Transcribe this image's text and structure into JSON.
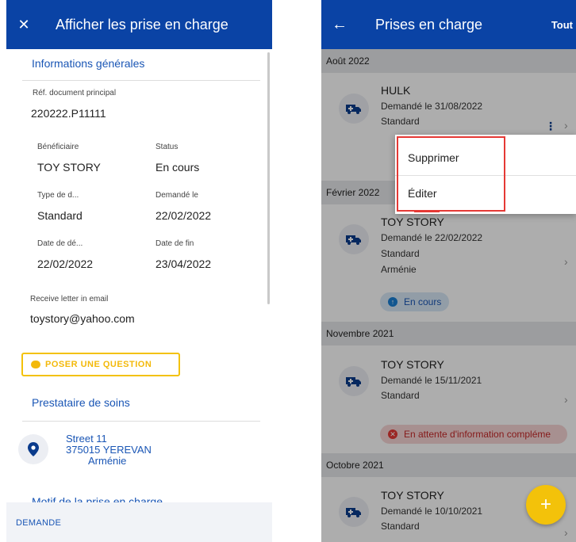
{
  "left": {
    "title": "Afficher les prise en charge",
    "section_general": "Informations générales",
    "fields": {
      "ref_label": "Réf. document principal",
      "ref_value": "220222.P11111",
      "beneficiaire_label": "Bénéficiaire",
      "beneficiaire_value": "TOY STORY",
      "status_label": "Status",
      "status_value": "En cours",
      "type_label": "Type de d...",
      "type_value": "Standard",
      "demande_label": "Demandé le",
      "demande_value": "22/02/2022",
      "date_debut_label": "Date de dé...",
      "date_debut_value": "22/02/2022",
      "date_fin_label": "Date de fin",
      "date_fin_value": "23/04/2022",
      "email_label": "Receive letter in email",
      "email_value": "toystory@yahoo.com"
    },
    "ask_button": "POSER UNE QUESTION",
    "section_provider": "Prestataire de soins",
    "address": {
      "line1": "Street 11",
      "line2": "375015 YEREVAN",
      "line3": "Arménie"
    },
    "section_motif": "Motif de la prise en charge",
    "bottom_tab": "DEMANDE"
  },
  "right": {
    "title": "Prises en charge",
    "filter": "Tout",
    "months": [
      "Août 2022",
      "Février 2022",
      "Novembre 2021",
      "Octobre 2021"
    ],
    "cards": [
      {
        "name": "HULK",
        "requested": "Demandé le 31/08/2022",
        "type": "Standard"
      },
      {
        "name": "TOY STORY",
        "requested": "Demandé le 22/02/2022",
        "type": "Standard",
        "country": "Arménie",
        "status": "En cours"
      },
      {
        "name": "TOY STORY",
        "requested": "Demandé le 15/11/2021",
        "type": "Standard",
        "status": "En attente d'information compléme"
      },
      {
        "name": "TOY STORY",
        "requested": "Demandé le 10/10/2021",
        "type": "Standard"
      }
    ],
    "menu": {
      "delete": "Supprimer",
      "edit": "Éditer"
    },
    "fab": "+"
  },
  "colors": {
    "primary": "#0a43a5",
    "accent": "#f3c20a",
    "link": "#1a56b5",
    "status_info": "#1a7fd4",
    "status_warning": "#e53935",
    "highlight": "#e53935"
  }
}
